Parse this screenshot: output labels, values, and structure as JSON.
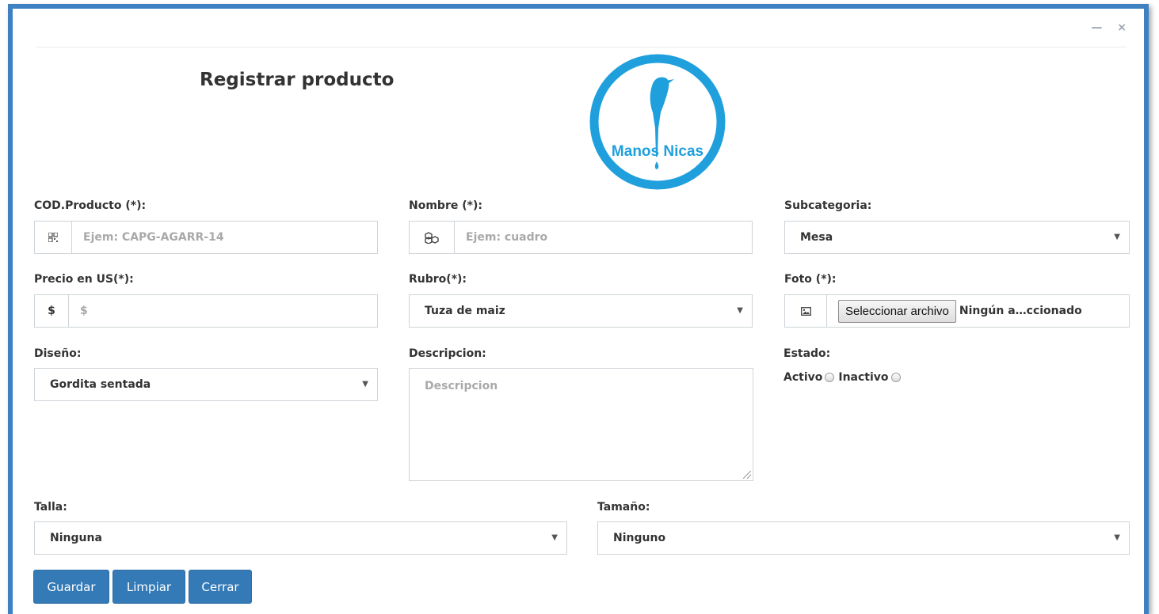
{
  "window": {
    "minimize_glyph": "—",
    "close_glyph": "×"
  },
  "page": {
    "title": "Registrar producto"
  },
  "logo": {
    "text": "Manos Nicas",
    "color": "#1fa0dd"
  },
  "form": {
    "cod": {
      "label": "COD.Producto (*):",
      "placeholder": "Ejem: CAPG-AGARR-14",
      "icon": "qrcode-icon"
    },
    "nombre": {
      "label": "Nombre (*):",
      "placeholder": "Ejem: cuadro",
      "icon": "cubes-icon"
    },
    "subcategoria": {
      "label": "Subcategoria:",
      "value": "Mesa"
    },
    "precio": {
      "label": "Precio en US(*):",
      "placeholder": "$",
      "addon": "$"
    },
    "rubro": {
      "label": "Rubro(*):",
      "value": "Tuza de maiz"
    },
    "foto": {
      "label": "Foto (*):",
      "button": "Seleccionar archivo",
      "file_status": "Ningún a…ccionado",
      "icon": "image-icon"
    },
    "diseno": {
      "label": "Diseño:",
      "value": "Gordita sentada"
    },
    "descripcion": {
      "label": "Descripcion:",
      "placeholder": "Descripcion"
    },
    "estado": {
      "label": "Estado:",
      "option_active": "Activo",
      "option_inactive": "Inactivo"
    },
    "talla": {
      "label": "Talla:",
      "value": "Ninguna"
    },
    "tamano": {
      "label": "Tamaño:",
      "value": "Ninguno"
    }
  },
  "buttons": {
    "save": "Guardar",
    "clear": "Limpiar",
    "close": "Cerrar"
  },
  "colors": {
    "primary": "#337ab7",
    "frame": "#3f80c2"
  }
}
